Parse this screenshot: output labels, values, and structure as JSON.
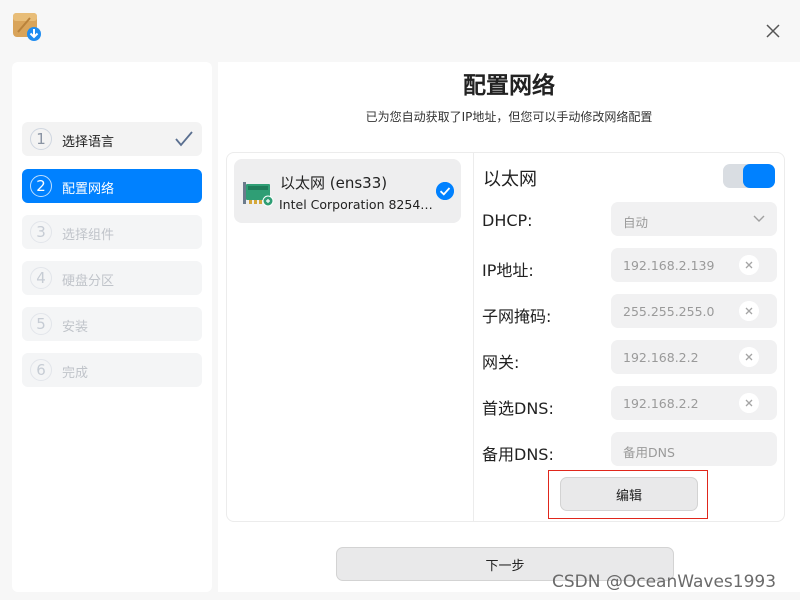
{
  "colors": {
    "accent": "#0081ff",
    "highlight_border": "#e0261b"
  },
  "titlebar": {
    "app_icon": "installer-package-icon",
    "close_icon": "close-icon"
  },
  "steps": [
    {
      "num": "1",
      "label": "选择语言",
      "state": "done"
    },
    {
      "num": "2",
      "label": "配置网络",
      "state": "active"
    },
    {
      "num": "3",
      "label": "选择组件",
      "state": "pending"
    },
    {
      "num": "4",
      "label": "硬盘分区",
      "state": "pending"
    },
    {
      "num": "5",
      "label": "安装",
      "state": "pending"
    },
    {
      "num": "6",
      "label": "完成",
      "state": "pending"
    }
  ],
  "main": {
    "title": "配置网络",
    "subtitle": "已为您自动获取了IP地址，但您可以手动修改网络配置"
  },
  "device": {
    "name": "以太网 (ens33)",
    "description": "Intel Corporation 8254…",
    "selected": true
  },
  "ethernet": {
    "title": "以太网",
    "enabled": true,
    "fields": {
      "dhcp": {
        "label": "DHCP:",
        "value": "自动"
      },
      "ip": {
        "label": "IP地址:",
        "value": "192.168.2.139"
      },
      "mask": {
        "label": "子网掩码:",
        "value": "255.255.255.0"
      },
      "gateway": {
        "label": "网关:",
        "value": "192.168.2.2"
      },
      "dns1": {
        "label": "首选DNS:",
        "value": "192.168.2.2"
      },
      "dns2": {
        "label": "备用DNS:",
        "placeholder": "备用DNS"
      }
    },
    "edit_label": "编辑"
  },
  "footer": {
    "next_label": "下一步"
  },
  "watermark": "CSDN @OceanWaves1993"
}
